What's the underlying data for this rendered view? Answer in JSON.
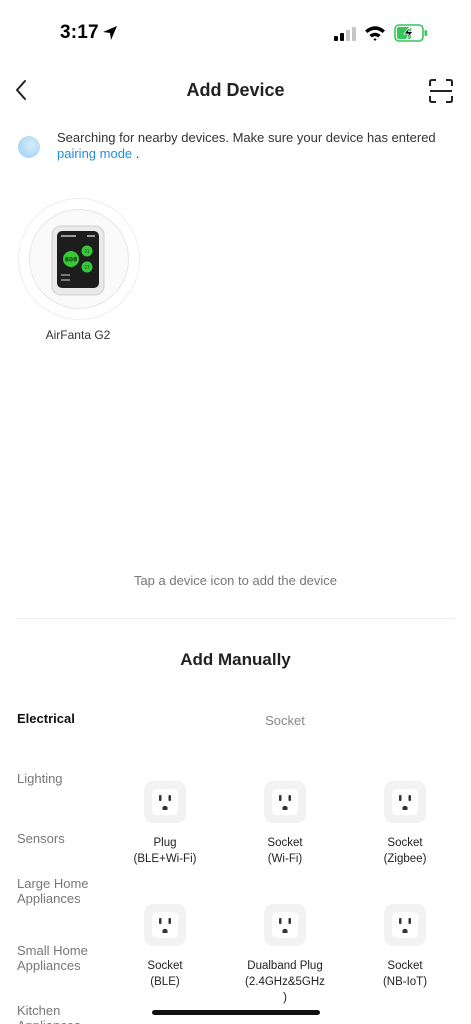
{
  "status_bar": {
    "time": "3:17",
    "icons": [
      "location-arrow-icon",
      "cellular-signal-icon",
      "wifi-icon",
      "battery-charging-icon"
    ],
    "battery_color": "#34c759"
  },
  "nav": {
    "title": "Add Device",
    "back_icon": "chevron-left-icon",
    "scan_icon": "scan-icon"
  },
  "search": {
    "text": "Searching for nearby devices. Make sure your device has entered",
    "link": "pairing mode",
    "suffix": " .",
    "link_color": "#1f8ce6"
  },
  "found_devices": [
    {
      "name": "AirFanta G2",
      "screen_values": [
        "608",
        "21",
        "27"
      ]
    }
  ],
  "tap_hint": "Tap a device icon to add the device",
  "manual": {
    "title": "Add Manually",
    "categories": [
      {
        "label": "Electrical",
        "active": true
      },
      {
        "label": "Lighting",
        "active": false
      },
      {
        "label": "Sensors",
        "active": false
      },
      {
        "label": "Large Home Appliances",
        "active": false
      },
      {
        "label": "Small Home Appliances",
        "active": false
      },
      {
        "label": "Kitchen Appliances",
        "active": false
      }
    ],
    "section": "Socket",
    "devices": [
      {
        "label": "Plug\n(BLE+Wi-Fi)",
        "icon": "socket-icon"
      },
      {
        "label": "Socket\n(Wi-Fi)",
        "icon": "socket-icon"
      },
      {
        "label": "Socket\n(Zigbee)",
        "icon": "socket-icon"
      },
      {
        "label": "Socket\n(BLE)",
        "icon": "socket-icon"
      },
      {
        "label": "Dualband Plug\n(2.4GHz&5GHz\n)",
        "icon": "socket-icon"
      },
      {
        "label": "Socket\n(NB-IoT)",
        "icon": "socket-icon"
      }
    ]
  }
}
